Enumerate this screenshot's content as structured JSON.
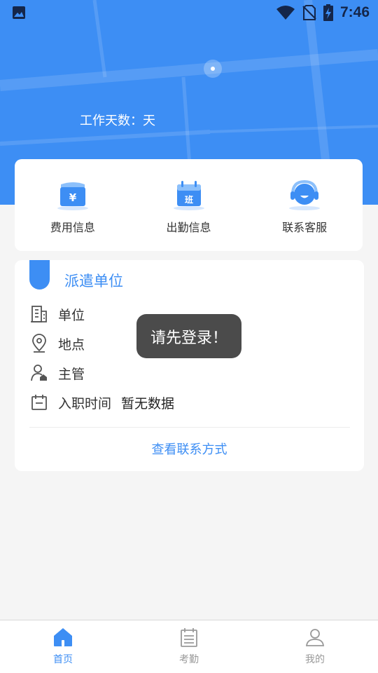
{
  "status_bar": {
    "time": "7:46",
    "icons": [
      "image-icon",
      "wifi-icon",
      "no-sim-icon",
      "battery-charging-icon"
    ]
  },
  "hero": {
    "work_days_label": "工作天数：天"
  },
  "quick_actions": [
    {
      "label": "费用信息",
      "icon": "fee-wallet-icon"
    },
    {
      "label": "出勤信息",
      "icon": "attendance-calendar-icon"
    },
    {
      "label": "联系客服",
      "icon": "customer-service-icon"
    }
  ],
  "dispatch": {
    "title": "派遣单位",
    "rows": [
      {
        "label": "单位",
        "icon": "building-icon",
        "value": ""
      },
      {
        "label": "地点",
        "icon": "location-pin-icon",
        "value": ""
      },
      {
        "label": "主管",
        "icon": "supervisor-icon",
        "value": ""
      },
      {
        "label": "入职时间",
        "icon": "calendar-icon",
        "value": "暂无数据"
      }
    ],
    "contact_link": "查看联系方式"
  },
  "toast": {
    "message": "请先登录！"
  },
  "tabbar": {
    "tabs": [
      {
        "label": "首页",
        "icon": "home-icon",
        "active": true
      },
      {
        "label": "考勤",
        "icon": "attendance-icon",
        "active": false
      },
      {
        "label": "我的",
        "icon": "profile-icon",
        "active": false
      }
    ]
  },
  "colors": {
    "accent": "#3d8ef4",
    "hero_bg": "#3d8ef4",
    "page_bg": "#f5f5f5",
    "toast_bg": "#3c3c3c",
    "status_icons": "#14264a"
  }
}
